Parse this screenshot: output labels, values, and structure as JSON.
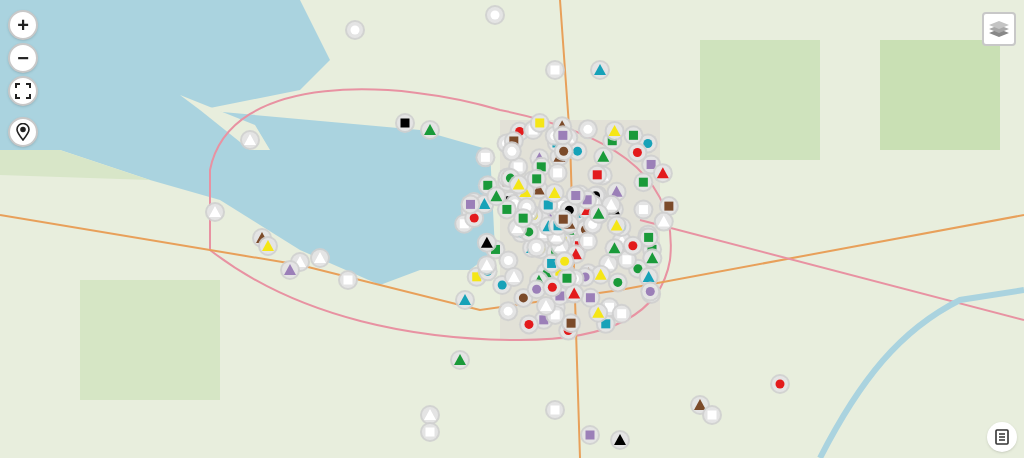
{
  "zoom_controls": {
    "zoom_in": "+",
    "zoom_out": "−"
  }
}
